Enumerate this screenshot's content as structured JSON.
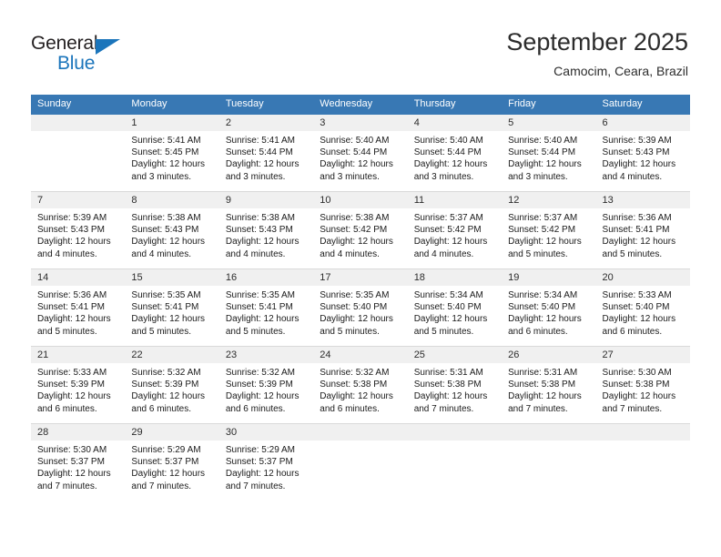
{
  "logo": {
    "text_primary": "General",
    "text_secondary": "Blue",
    "color_primary": "#231f20",
    "color_secondary": "#1b75bb",
    "triangle_icon": "triangle-icon"
  },
  "header": {
    "title": "September 2025",
    "subtitle": "Camocim, Ceara, Brazil"
  },
  "theme": {
    "header_bg": "#3878b4",
    "header_text": "#ffffff",
    "daynum_band_bg": "#f0f0f0",
    "row_divider": "#d9d9d9",
    "body_text": "#1a1a1a"
  },
  "calendar": {
    "weekday_headers": [
      "Sunday",
      "Monday",
      "Tuesday",
      "Wednesday",
      "Thursday",
      "Friday",
      "Saturday"
    ],
    "weeks": [
      [
        {
          "day": "",
          "lines": []
        },
        {
          "day": "1",
          "lines": [
            "Sunrise: 5:41 AM",
            "Sunset: 5:45 PM",
            "Daylight: 12 hours",
            "and 3 minutes."
          ]
        },
        {
          "day": "2",
          "lines": [
            "Sunrise: 5:41 AM",
            "Sunset: 5:44 PM",
            "Daylight: 12 hours",
            "and 3 minutes."
          ]
        },
        {
          "day": "3",
          "lines": [
            "Sunrise: 5:40 AM",
            "Sunset: 5:44 PM",
            "Daylight: 12 hours",
            "and 3 minutes."
          ]
        },
        {
          "day": "4",
          "lines": [
            "Sunrise: 5:40 AM",
            "Sunset: 5:44 PM",
            "Daylight: 12 hours",
            "and 3 minutes."
          ]
        },
        {
          "day": "5",
          "lines": [
            "Sunrise: 5:40 AM",
            "Sunset: 5:44 PM",
            "Daylight: 12 hours",
            "and 3 minutes."
          ]
        },
        {
          "day": "6",
          "lines": [
            "Sunrise: 5:39 AM",
            "Sunset: 5:43 PM",
            "Daylight: 12 hours",
            "and 4 minutes."
          ]
        }
      ],
      [
        {
          "day": "7",
          "lines": [
            "Sunrise: 5:39 AM",
            "Sunset: 5:43 PM",
            "Daylight: 12 hours",
            "and 4 minutes."
          ]
        },
        {
          "day": "8",
          "lines": [
            "Sunrise: 5:38 AM",
            "Sunset: 5:43 PM",
            "Daylight: 12 hours",
            "and 4 minutes."
          ]
        },
        {
          "day": "9",
          "lines": [
            "Sunrise: 5:38 AM",
            "Sunset: 5:43 PM",
            "Daylight: 12 hours",
            "and 4 minutes."
          ]
        },
        {
          "day": "10",
          "lines": [
            "Sunrise: 5:38 AM",
            "Sunset: 5:42 PM",
            "Daylight: 12 hours",
            "and 4 minutes."
          ]
        },
        {
          "day": "11",
          "lines": [
            "Sunrise: 5:37 AM",
            "Sunset: 5:42 PM",
            "Daylight: 12 hours",
            "and 4 minutes."
          ]
        },
        {
          "day": "12",
          "lines": [
            "Sunrise: 5:37 AM",
            "Sunset: 5:42 PM",
            "Daylight: 12 hours",
            "and 5 minutes."
          ]
        },
        {
          "day": "13",
          "lines": [
            "Sunrise: 5:36 AM",
            "Sunset: 5:41 PM",
            "Daylight: 12 hours",
            "and 5 minutes."
          ]
        }
      ],
      [
        {
          "day": "14",
          "lines": [
            "Sunrise: 5:36 AM",
            "Sunset: 5:41 PM",
            "Daylight: 12 hours",
            "and 5 minutes."
          ]
        },
        {
          "day": "15",
          "lines": [
            "Sunrise: 5:35 AM",
            "Sunset: 5:41 PM",
            "Daylight: 12 hours",
            "and 5 minutes."
          ]
        },
        {
          "day": "16",
          "lines": [
            "Sunrise: 5:35 AM",
            "Sunset: 5:41 PM",
            "Daylight: 12 hours",
            "and 5 minutes."
          ]
        },
        {
          "day": "17",
          "lines": [
            "Sunrise: 5:35 AM",
            "Sunset: 5:40 PM",
            "Daylight: 12 hours",
            "and 5 minutes."
          ]
        },
        {
          "day": "18",
          "lines": [
            "Sunrise: 5:34 AM",
            "Sunset: 5:40 PM",
            "Daylight: 12 hours",
            "and 5 minutes."
          ]
        },
        {
          "day": "19",
          "lines": [
            "Sunrise: 5:34 AM",
            "Sunset: 5:40 PM",
            "Daylight: 12 hours",
            "and 6 minutes."
          ]
        },
        {
          "day": "20",
          "lines": [
            "Sunrise: 5:33 AM",
            "Sunset: 5:40 PM",
            "Daylight: 12 hours",
            "and 6 minutes."
          ]
        }
      ],
      [
        {
          "day": "21",
          "lines": [
            "Sunrise: 5:33 AM",
            "Sunset: 5:39 PM",
            "Daylight: 12 hours",
            "and 6 minutes."
          ]
        },
        {
          "day": "22",
          "lines": [
            "Sunrise: 5:32 AM",
            "Sunset: 5:39 PM",
            "Daylight: 12 hours",
            "and 6 minutes."
          ]
        },
        {
          "day": "23",
          "lines": [
            "Sunrise: 5:32 AM",
            "Sunset: 5:39 PM",
            "Daylight: 12 hours",
            "and 6 minutes."
          ]
        },
        {
          "day": "24",
          "lines": [
            "Sunrise: 5:32 AM",
            "Sunset: 5:38 PM",
            "Daylight: 12 hours",
            "and 6 minutes."
          ]
        },
        {
          "day": "25",
          "lines": [
            "Sunrise: 5:31 AM",
            "Sunset: 5:38 PM",
            "Daylight: 12 hours",
            "and 7 minutes."
          ]
        },
        {
          "day": "26",
          "lines": [
            "Sunrise: 5:31 AM",
            "Sunset: 5:38 PM",
            "Daylight: 12 hours",
            "and 7 minutes."
          ]
        },
        {
          "day": "27",
          "lines": [
            "Sunrise: 5:30 AM",
            "Sunset: 5:38 PM",
            "Daylight: 12 hours",
            "and 7 minutes."
          ]
        }
      ],
      [
        {
          "day": "28",
          "lines": [
            "Sunrise: 5:30 AM",
            "Sunset: 5:37 PM",
            "Daylight: 12 hours",
            "and 7 minutes."
          ]
        },
        {
          "day": "29",
          "lines": [
            "Sunrise: 5:29 AM",
            "Sunset: 5:37 PM",
            "Daylight: 12 hours",
            "and 7 minutes."
          ]
        },
        {
          "day": "30",
          "lines": [
            "Sunrise: 5:29 AM",
            "Sunset: 5:37 PM",
            "Daylight: 12 hours",
            "and 7 minutes."
          ]
        },
        {
          "day": "",
          "lines": []
        },
        {
          "day": "",
          "lines": []
        },
        {
          "day": "",
          "lines": []
        },
        {
          "day": "",
          "lines": []
        }
      ]
    ]
  }
}
